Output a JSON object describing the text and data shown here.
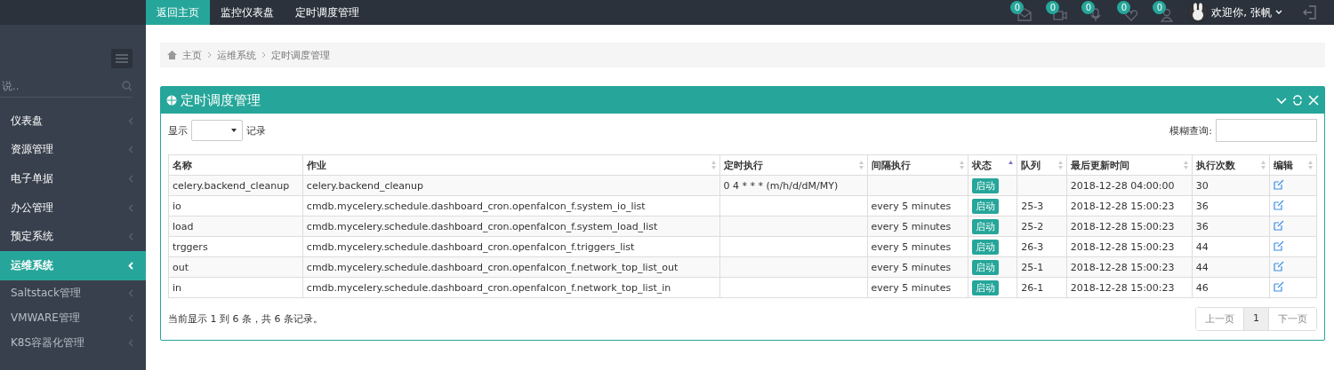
{
  "top_nav": {
    "tabs": [
      {
        "label": "返回主页",
        "selected": true
      },
      {
        "label": "监控仪表盘",
        "selected": false
      },
      {
        "label": "定时调度管理",
        "selected": false
      }
    ],
    "notifications": [
      {
        "kind": "mail",
        "count": "0"
      },
      {
        "kind": "video",
        "count": "0"
      },
      {
        "kind": "mic",
        "count": "0"
      },
      {
        "kind": "heart",
        "count": "0"
      },
      {
        "kind": "user",
        "count": "0"
      }
    ],
    "user": {
      "greeting": "欢迎你, 张帆"
    }
  },
  "sidebar": {
    "search": {
      "placeholder": "说.."
    },
    "items": [
      {
        "label": "仪表盘",
        "selected": false
      },
      {
        "label": "资源管理",
        "selected": false
      },
      {
        "label": "电子单据",
        "selected": false
      },
      {
        "label": "办公管理",
        "selected": false
      },
      {
        "label": "预定系统",
        "selected": false
      },
      {
        "label": "运维系统",
        "selected": true,
        "children": [
          {
            "label": "Saltstack管理"
          },
          {
            "label": "VMWARE管理"
          },
          {
            "label": "K8S容器化管理"
          }
        ]
      }
    ]
  },
  "breadcrumb": [
    "主页",
    "运维系统",
    "定时调度管理"
  ],
  "panel": {
    "title": "定时调度管理",
    "length_label_before": "显示",
    "length_label_after": "记录",
    "search_label": "模糊查询:",
    "table": {
      "columns": [
        {
          "label": "名称",
          "sortable": false,
          "sorted": false
        },
        {
          "label": "作业",
          "sortable": true,
          "sorted": false
        },
        {
          "label": "定时执行",
          "sortable": true,
          "sorted": false
        },
        {
          "label": "间隔执行",
          "sortable": true,
          "sorted": false
        },
        {
          "label": "状态",
          "sortable": true,
          "sorted": true
        },
        {
          "label": "队列",
          "sortable": true,
          "sorted": false
        },
        {
          "label": "最后更新时间",
          "sortable": true,
          "sorted": false
        },
        {
          "label": "执行次数",
          "sortable": true,
          "sorted": false
        },
        {
          "label": "编辑",
          "sortable": true,
          "sorted": false
        }
      ],
      "rows": [
        {
          "name": "celery.backend_cleanup",
          "task": "celery.backend_cleanup",
          "crontab": "0 4 * * * (m/h/d/dM/MY)",
          "interval": "",
          "status": "启动",
          "queue": "",
          "updated": "2018-12-28 04:00:00",
          "runs": "30"
        },
        {
          "name": "io",
          "task": "cmdb.mycelery.schedule.dashboard_cron.openfalcon_f.system_io_list",
          "crontab": "",
          "interval": "every 5 minutes",
          "status": "启动",
          "queue": "25-3",
          "updated": "2018-12-28 15:00:23",
          "runs": "36"
        },
        {
          "name": "load",
          "task": "cmdb.mycelery.schedule.dashboard_cron.openfalcon_f.system_load_list",
          "crontab": "",
          "interval": "every 5 minutes",
          "status": "启动",
          "queue": "25-2",
          "updated": "2018-12-28 15:00:23",
          "runs": "36"
        },
        {
          "name": "trggers",
          "task": "cmdb.mycelery.schedule.dashboard_cron.openfalcon_f.triggers_list",
          "crontab": "",
          "interval": "every 5 minutes",
          "status": "启动",
          "queue": "26-3",
          "updated": "2018-12-28 15:00:23",
          "runs": "44"
        },
        {
          "name": "out",
          "task": "cmdb.mycelery.schedule.dashboard_cron.openfalcon_f.network_top_list_out",
          "crontab": "",
          "interval": "every 5 minutes",
          "status": "启动",
          "queue": "25-1",
          "updated": "2018-12-28 15:00:23",
          "runs": "44"
        },
        {
          "name": "in",
          "task": "cmdb.mycelery.schedule.dashboard_cron.openfalcon_f.network_top_list_in",
          "crontab": "",
          "interval": "every 5 minutes",
          "status": "启动",
          "queue": "26-1",
          "updated": "2018-12-28 15:00:23",
          "runs": "46"
        }
      ]
    },
    "info": "当前显示 1 到 6 条，共 6 条记录。",
    "pagination": [
      {
        "label": "上一页",
        "selected": false
      },
      {
        "label": "1",
        "selected": true
      },
      {
        "label": "下一页",
        "selected": false
      }
    ]
  }
}
